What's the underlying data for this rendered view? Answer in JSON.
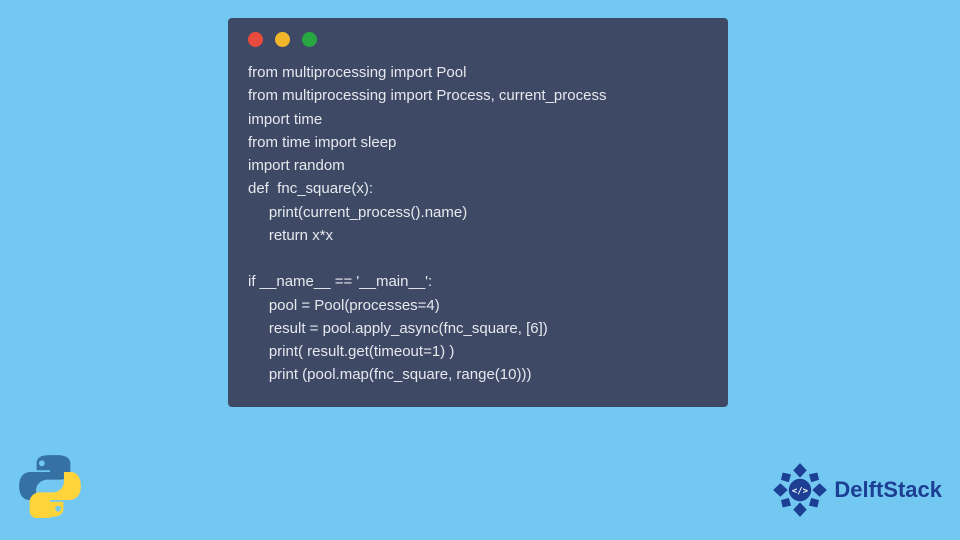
{
  "colors": {
    "background": "#72c8f1",
    "window_bg": "#3e4a65",
    "code_text": "#e6e8ee",
    "dot_red": "#e84b3e",
    "dot_yellow": "#f0b72a",
    "dot_green": "#27a641",
    "brand_blue": "#1c3f94"
  },
  "code_lines": [
    "from multiprocessing import Pool",
    "from multiprocessing import Process, current_process",
    "import time",
    "from time import sleep",
    "import random",
    "def  fnc_square(x):",
    "     print(current_process().name)",
    "     return x*x",
    "",
    "if __name__ == '__main__':",
    "     pool = Pool(processes=4)",
    "     result = pool.apply_async(fnc_square, [6])",
    "     print( result.get(timeout=1) )",
    "     print (pool.map(fnc_square, range(10)))"
  ],
  "brand": {
    "name": "DelftStack"
  },
  "icons": {
    "window_close": "red-dot",
    "window_minimize": "yellow-dot",
    "window_maximize": "green-dot",
    "python": "python-logo",
    "brand": "delftstack-logo"
  }
}
